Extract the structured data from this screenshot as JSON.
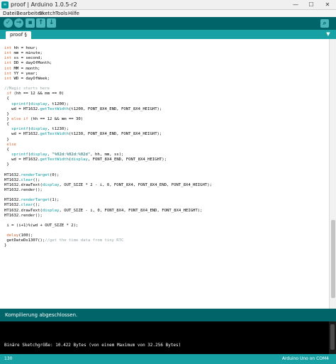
{
  "window": {
    "title": "proof | Arduino 1.0.5-r2",
    "app_icon_text": "∞",
    "minimize": "—",
    "maximize": "☐",
    "close": "✕"
  },
  "menu": [
    "Datei",
    "Bearbeiten",
    "Sketch",
    "Tools",
    "Hilfe"
  ],
  "toolbar": {
    "verify_icon": "✓",
    "upload_icon": "→",
    "new_icon": "▪",
    "open_icon": "↑",
    "save_icon": "↓",
    "serial_icon": "⌕"
  },
  "tabs": {
    "active": "proof §",
    "menu_icon": "▼"
  },
  "editor": {
    "lines": [
      [
        {
          "t": "int",
          "c": "kw"
        },
        {
          "t": " hh = hour;"
        }
      ],
      [
        {
          "t": "int",
          "c": "kw"
        },
        {
          "t": " mm = minute;"
        }
      ],
      [
        {
          "t": "int",
          "c": "kw"
        },
        {
          "t": " ss = second;"
        }
      ],
      [
        {
          "t": "int",
          "c": "kw"
        },
        {
          "t": " DD = dayOfMonth;"
        }
      ],
      [
        {
          "t": "int",
          "c": "kw"
        },
        {
          "t": " MM = month;"
        }
      ],
      [
        {
          "t": "int",
          "c": "kw"
        },
        {
          "t": " YY = year;"
        }
      ],
      [
        {
          "t": "int",
          "c": "kw"
        },
        {
          "t": " WD = dayOfWeek;"
        }
      ],
      [
        {
          "t": ""
        }
      ],
      [
        {
          "t": "//Magic starts here",
          "c": "cm"
        }
      ],
      [
        {
          "t": " if",
          "c": "kw"
        },
        {
          "t": " (hh == 12 && mm == 0)"
        }
      ],
      [
        {
          "t": " {"
        }
      ],
      [
        {
          "t": "   "
        },
        {
          "t": "sprintf",
          "c": "fn"
        },
        {
          "t": "("
        },
        {
          "t": "display",
          "c": "fn"
        },
        {
          "t": ", t1200);"
        }
      ],
      [
        {
          "t": "   wd = HT1632."
        },
        {
          "t": "getTextWidth",
          "c": "fn"
        },
        {
          "t": "(t1200, FONT_8X4_END, FONT_8X4_HEIGHT);"
        }
      ],
      [
        {
          "t": " }"
        }
      ],
      [
        {
          "t": " } "
        },
        {
          "t": "else if",
          "c": "kw"
        },
        {
          "t": " (hh == 12 && mm == 30)"
        }
      ],
      [
        {
          "t": " {"
        }
      ],
      [
        {
          "t": "   "
        },
        {
          "t": "sprintf",
          "c": "fn"
        },
        {
          "t": "("
        },
        {
          "t": "display",
          "c": "fn"
        },
        {
          "t": ", t1230);"
        }
      ],
      [
        {
          "t": "   wd = HT1632."
        },
        {
          "t": "getTextWidth",
          "c": "fn"
        },
        {
          "t": "(t1230, FONT_8X4_END, FONT_8X4_HEIGHT);"
        }
      ],
      [
        {
          "t": " }"
        }
      ],
      [
        {
          "t": " else",
          "c": "kw"
        }
      ],
      [
        {
          "t": " {"
        }
      ],
      [
        {
          "t": "   "
        },
        {
          "t": "sprintf",
          "c": "fn"
        },
        {
          "t": "("
        },
        {
          "t": "display",
          "c": "fn"
        },
        {
          "t": ", "
        },
        {
          "t": "\"%02d:%02d:%02d\"",
          "c": "st"
        },
        {
          "t": ", hh, mm, ss);"
        }
      ],
      [
        {
          "t": "   wd = HT1632."
        },
        {
          "t": "getTextWidth",
          "c": "fn"
        },
        {
          "t": "("
        },
        {
          "t": "display",
          "c": "fn"
        },
        {
          "t": ", FONT_8X4_END, FONT_8X4_HEIGHT);"
        }
      ],
      [
        {
          "t": " }"
        }
      ],
      [
        {
          "t": ""
        }
      ],
      [
        {
          "t": "HT1632."
        },
        {
          "t": "renderTarget",
          "c": "fn"
        },
        {
          "t": "(0);"
        }
      ],
      [
        {
          "t": "HT1632."
        },
        {
          "t": "clear",
          "c": "fn"
        },
        {
          "t": "();"
        }
      ],
      [
        {
          "t": "HT1632.drawText("
        },
        {
          "t": "display",
          "c": "fn"
        },
        {
          "t": ", OUT_SIZE * 2 - i, 0, FONT_8X4, FONT_8X4_END, FONT_8X4_HEIGHT);"
        }
      ],
      [
        {
          "t": "HT1632.render();"
        }
      ],
      [
        {
          "t": ""
        }
      ],
      [
        {
          "t": "HT1632."
        },
        {
          "t": "renderTarget",
          "c": "fn"
        },
        {
          "t": "(1);"
        }
      ],
      [
        {
          "t": "HT1632."
        },
        {
          "t": "clear",
          "c": "fn"
        },
        {
          "t": "();"
        }
      ],
      [
        {
          "t": "HT1632.drawText("
        },
        {
          "t": "display",
          "c": "fn"
        },
        {
          "t": ", OUT_SIZE - i, 0, FONT_8X4, FONT_8X4_END, FONT_8X4_HEIGHT);"
        }
      ],
      [
        {
          "t": "HT1632.render();"
        }
      ],
      [
        {
          "t": ""
        }
      ],
      [
        {
          "t": " i = (i+1)%(wd + OUT_SIZE * 2);"
        }
      ],
      [
        {
          "t": ""
        }
      ],
      [
        {
          "t": " "
        },
        {
          "t": "delay",
          "c": "kw"
        },
        {
          "t": "(100);"
        }
      ],
      [
        {
          "t": " getDateDs1307();"
        },
        {
          "t": "//get the time data from tiny RTC",
          "c": "cm"
        }
      ],
      [
        {
          "t": "}"
        }
      ]
    ]
  },
  "status": {
    "message": "Kompilierung abgeschlossen."
  },
  "console": {
    "output": "Binäre Sketchgröße: 10.422 Bytes (von einem Maximum von 32.256 Bytes)"
  },
  "footer": {
    "line_number": "130",
    "board": "Arduino Uno on COM4"
  },
  "colors": {
    "teal_dark": "#006468",
    "teal_light": "#17a1a5",
    "keyword": "#cc6633",
    "function": "#00979c"
  }
}
